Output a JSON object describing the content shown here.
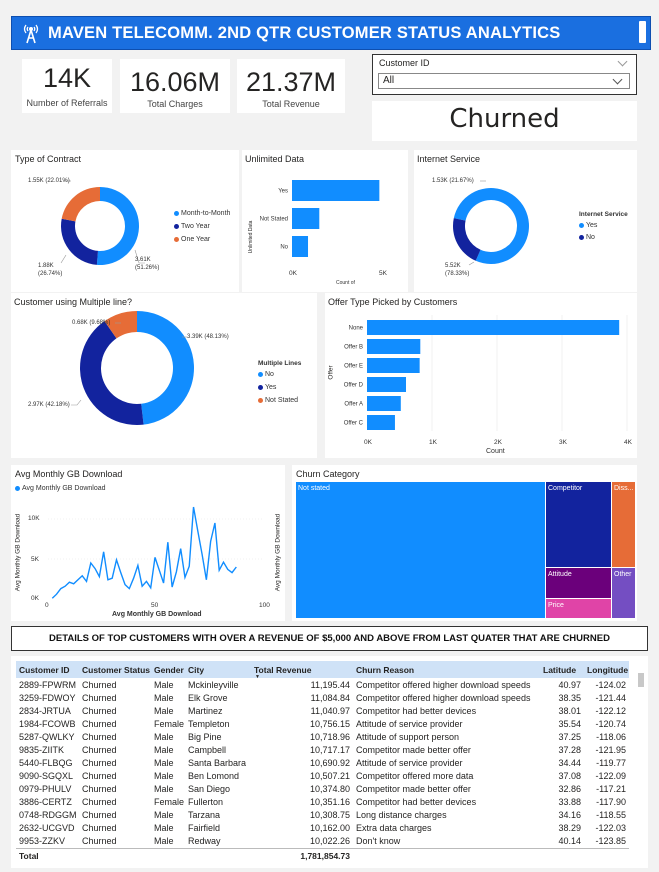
{
  "header": {
    "title": "MAVEN  TELECOMM. 2ND QTR CUSTOMER STATUS ANALYTICS",
    "icon": "signal-tower-icon"
  },
  "kpis": [
    {
      "value": "14K",
      "label": "Number of Referrals"
    },
    {
      "value": "16.06M",
      "label": "Total Charges"
    },
    {
      "value": "21.37M",
      "label": "Total Revenue"
    }
  ],
  "slicer": {
    "label": "Customer ID",
    "value": "All"
  },
  "status_card": {
    "value": "Churned"
  },
  "colors": {
    "blue": "#118dff",
    "navy": "#12239e",
    "orange": "#e66c37",
    "purple": "#6b007b",
    "pink": "#e044a7",
    "violet": "#744ec2",
    "header": "#1a6fe0"
  },
  "chart_data": [
    {
      "id": "contract",
      "type": "pie",
      "title": "Type of Contract",
      "categories": [
        "Month-to-Month",
        "Two Year",
        "One Year"
      ],
      "values": [
        3610,
        1880,
        1550
      ],
      "labels": [
        "3.61K\n(51.26%)",
        "1.88K\n(26.74%)",
        "1.55K (22.01%)"
      ]
    },
    {
      "id": "unlimited",
      "type": "bar",
      "title": "Unlimited Data",
      "categories": [
        "Yes",
        "Not Stated",
        "No"
      ],
      "values": [
        4800,
        1500,
        880
      ],
      "xlabel": "Count of",
      "ylabel": "Unlimited Data",
      "xticks": [
        "0K",
        "5K"
      ],
      "xlim": [
        0,
        5000
      ]
    },
    {
      "id": "internet",
      "type": "pie",
      "title": "Internet Service",
      "categories": [
        "Yes",
        "No"
      ],
      "values": [
        5520,
        1530
      ],
      "labels": [
        "5.52K\n(78.33%)",
        "1.53K (21.67%)"
      ],
      "legend_title": "Internet Service"
    },
    {
      "id": "multiline",
      "type": "pie",
      "title": "Customer using Multiple line?",
      "categories": [
        "No",
        "Yes",
        "Not Stated"
      ],
      "values": [
        3390,
        2970,
        680
      ],
      "labels": [
        "3.39K (48.13%)",
        "2.97K (42.18%)",
        "0.68K (9.68%)"
      ],
      "legend_title": "Multiple Lines"
    },
    {
      "id": "offer",
      "type": "bar",
      "title": "Offer Type Picked by Customers",
      "categories": [
        "None",
        "Offer B",
        "Offer E",
        "Offer D",
        "Offer A",
        "Offer C"
      ],
      "values": [
        3880,
        820,
        810,
        600,
        520,
        430
      ],
      "xlabel": "Count",
      "ylabel": "Offer",
      "xticks": [
        "0K",
        "1K",
        "2K",
        "3K",
        "4K"
      ],
      "xlim": [
        0,
        4000
      ]
    },
    {
      "id": "gb",
      "type": "line",
      "title": "Avg Monthly GB Download",
      "series": [
        {
          "name": "Avg Monthly GB Download",
          "x": [
            2,
            4,
            6,
            8,
            10,
            12,
            14,
            16,
            18,
            20,
            22,
            24,
            26,
            28,
            30,
            32,
            34,
            36,
            38,
            40,
            42,
            44,
            46,
            48,
            50,
            52,
            54,
            56,
            58,
            60,
            62,
            64,
            66,
            68,
            70,
            72,
            74,
            76,
            78,
            80,
            82,
            84,
            86,
            88
          ],
          "y": [
            100,
            600,
            1300,
            1600,
            2100,
            1900,
            2400,
            2900,
            2200,
            4500,
            3800,
            2800,
            5900,
            2400,
            2600,
            4900,
            3300,
            1800,
            1300,
            2600,
            4200,
            1600,
            2200,
            1400,
            5200,
            3600,
            2000,
            7100,
            1500,
            3400,
            6300,
            2700,
            4100,
            11500,
            8500,
            5600,
            2400,
            7200,
            9500,
            3600,
            4600,
            3700,
            3300,
            4000
          ]
        }
      ],
      "xlabel": "Avg Monthly GB Download",
      "ylabel": "Avg Monthly GB Download",
      "xticks": [
        "0",
        "50",
        "100"
      ],
      "yticks": [
        "0K",
        "5K",
        "10K"
      ],
      "xlim": [
        0,
        100
      ],
      "ylim": [
        0,
        12000
      ]
    },
    {
      "id": "churncat",
      "type": "heatmap",
      "title": "Churn Category",
      "categories": [
        "Not stated",
        "Competitor",
        "Dissatisfaction",
        "Attitude",
        "Price",
        "Other"
      ],
      "display_labels": [
        "Not stated",
        "Competitor",
        "Diss...",
        "Attitude",
        "Price",
        "Other"
      ]
    }
  ],
  "banner": {
    "text": "DETAILS OF TOP  CUSTOMERS WITH OVER A REVENUE OF  $5,000  AND ABOVE FROM LAST QUATER THAT ARE CHURNED"
  },
  "table": {
    "columns": [
      "Customer ID",
      "Customer Status",
      "Gender",
      "City",
      "Total Revenue",
      "Churn Reason",
      "Latitude",
      "Longitude"
    ],
    "rows": [
      [
        "2889-FPWRM",
        "Churned",
        "Male",
        "Mckinleyville",
        "11,195.44",
        "Competitor offered higher download speeds",
        "40.97",
        "-124.02"
      ],
      [
        "3259-FDWOY",
        "Churned",
        "Male",
        "Elk Grove",
        "11,084.84",
        "Competitor offered higher download speeds",
        "38.35",
        "-121.44"
      ],
      [
        "2834-JRTUA",
        "Churned",
        "Male",
        "Martinez",
        "11,040.97",
        "Competitor had better devices",
        "38.01",
        "-122.12"
      ],
      [
        "1984-FCOWB",
        "Churned",
        "Female",
        "Templeton",
        "10,756.15",
        "Attitude of service provider",
        "35.54",
        "-120.74"
      ],
      [
        "5287-QWLKY",
        "Churned",
        "Male",
        "Big Pine",
        "10,718.96",
        "Attitude of support person",
        "37.25",
        "-118.06"
      ],
      [
        "9835-ZIITK",
        "Churned",
        "Male",
        "Campbell",
        "10,717.17",
        "Competitor made better offer",
        "37.28",
        "-121.95"
      ],
      [
        "5440-FLBQG",
        "Churned",
        "Male",
        "Santa Barbara",
        "10,690.92",
        "Attitude of service provider",
        "34.44",
        "-119.77"
      ],
      [
        "9090-SGQXL",
        "Churned",
        "Male",
        "Ben Lomond",
        "10,507.21",
        "Competitor offered more data",
        "37.08",
        "-122.09"
      ],
      [
        "0979-PHULV",
        "Churned",
        "Male",
        "San Diego",
        "10,374.80",
        "Competitor made better offer",
        "32.86",
        "-117.21"
      ],
      [
        "3886-CERTZ",
        "Churned",
        "Female",
        "Fullerton",
        "10,351.16",
        "Competitor had better devices",
        "33.88",
        "-117.90"
      ],
      [
        "0748-RDGGM",
        "Churned",
        "Male",
        "Tarzana",
        "10,308.75",
        "Long distance charges",
        "34.16",
        "-118.55"
      ],
      [
        "2632-UCGVD",
        "Churned",
        "Male",
        "Fairfield",
        "10,162.00",
        "Extra data charges",
        "38.29",
        "-122.03"
      ],
      [
        "9953-ZZKV",
        "Churned",
        "Male",
        "Redway",
        "10,022.26",
        "Don't know",
        "40.14",
        "-123.85"
      ]
    ],
    "total_label": "Total",
    "total_value": "1,781,854.73"
  }
}
